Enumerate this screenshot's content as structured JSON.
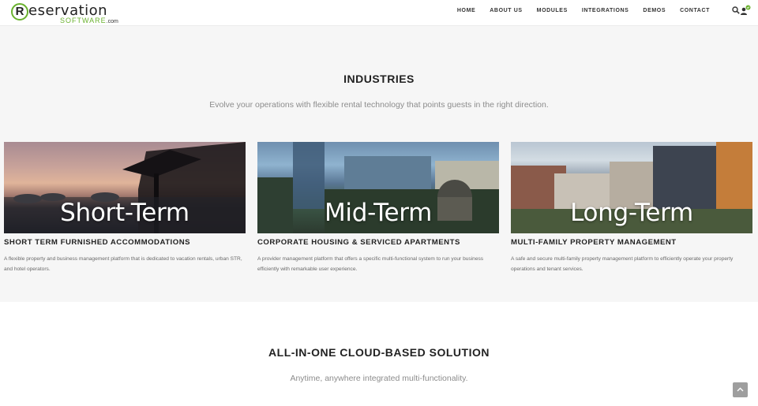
{
  "logo": {
    "initial": "R",
    "main": "eservation",
    "sub": "SOFTWARE",
    "dotcom": ".com"
  },
  "nav": {
    "items": [
      {
        "label": "HOME"
      },
      {
        "label": "ABOUT US"
      },
      {
        "label": "MODULES"
      },
      {
        "label": "INTEGRATIONS"
      },
      {
        "label": "DEMOS"
      },
      {
        "label": "CONTACT"
      }
    ],
    "icons": [
      "search-icon",
      "user-icon"
    ]
  },
  "industries": {
    "title": "INDUSTRIES",
    "subtitle": "Evolve your operations with flexible rental technology that points guests in the right direction.",
    "cards": [
      {
        "caption": "Short-Term",
        "heading": "SHORT TERM FURNISHED ACCOMMODATIONS",
        "text": "A flexible property and business management platform that is dedicated to vacation rentals, urban STR, and hotel operators."
      },
      {
        "caption": "Mid-Term",
        "heading": "CORPORATE HOUSING & SERVICED APARTMENTS",
        "text": "A provider management platform that offers a specific multi-functional system to run your business efficiently with remarkable user experience."
      },
      {
        "caption": "Long-Term",
        "heading": "MULTI-FAMILY PROPERTY MANAGEMENT",
        "text": "A safe and secure multi-family property management platform to efficiently operate your property operations and tenant services."
      }
    ]
  },
  "cloud": {
    "title": "ALL-IN-ONE CLOUD-BASED SOLUTION",
    "subtitle": "Anytime, anywhere integrated multi-functionality."
  },
  "colors": {
    "brand_green": "#6ab22e",
    "section_bg": "#f6f6f6",
    "scroll_button": "#9e9e9e"
  }
}
